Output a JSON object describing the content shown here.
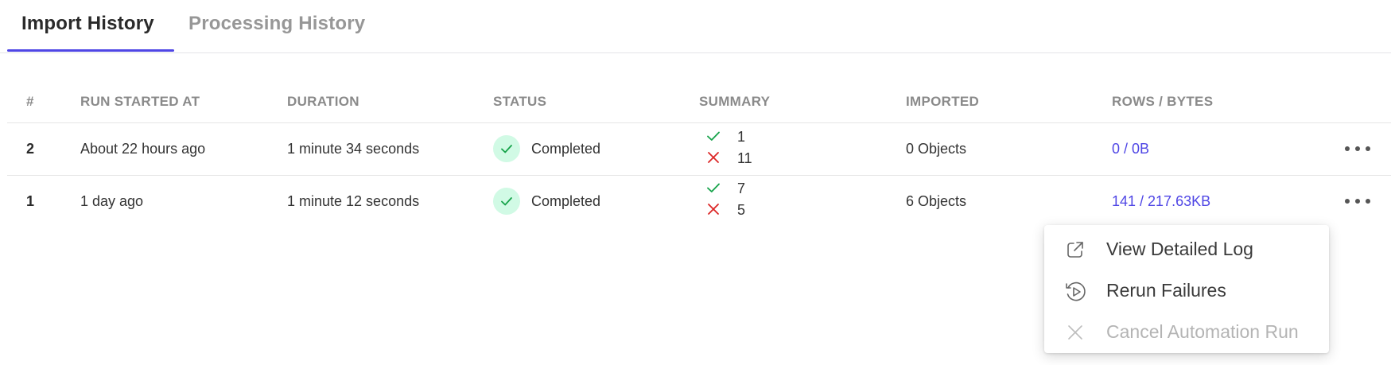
{
  "tabs": [
    {
      "label": "Import History",
      "active": true
    },
    {
      "label": "Processing History",
      "active": false
    }
  ],
  "table": {
    "headers": [
      "#",
      "RUN STARTED AT",
      "DURATION",
      "STATUS",
      "SUMMARY",
      "IMPORTED",
      "ROWS / BYTES"
    ],
    "rows": [
      {
        "index": "2",
        "started": "About 22 hours ago",
        "duration": "1 minute 34 seconds",
        "status": "Completed",
        "success": "1",
        "failed": "11",
        "imported": "0 Objects",
        "rows_bytes": "0 / 0B"
      },
      {
        "index": "1",
        "started": "1 day ago",
        "duration": "1 minute 12 seconds",
        "status": "Completed",
        "success": "7",
        "failed": "5",
        "imported": "6 Objects",
        "rows_bytes": "141 / 217.63KB"
      }
    ]
  },
  "menu": {
    "items": [
      {
        "label": "View Detailed Log",
        "icon": "external-link-icon",
        "disabled": false
      },
      {
        "label": "Rerun Failures",
        "icon": "rerun-icon",
        "disabled": false
      },
      {
        "label": "Cancel Automation Run",
        "icon": "close-icon",
        "disabled": true
      }
    ]
  },
  "colors": {
    "accent": "#4f46e5",
    "success": "#16a34a",
    "error": "#dc2626",
    "status_bg": "#d1fae5"
  }
}
